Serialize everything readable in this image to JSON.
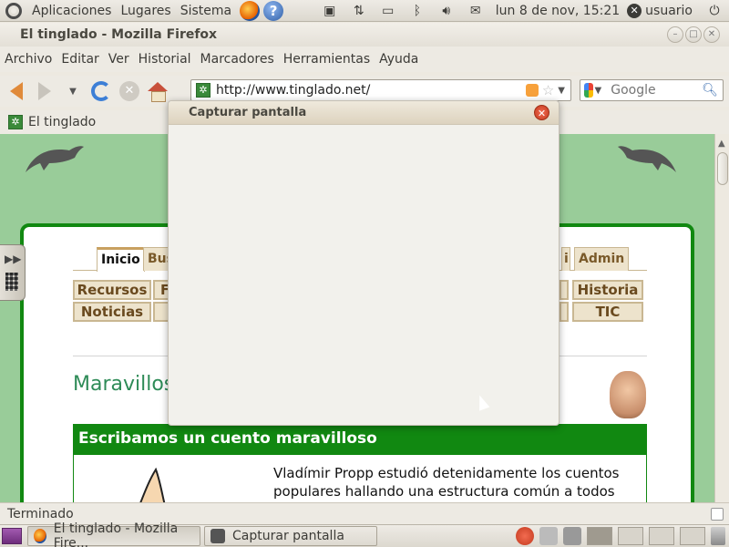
{
  "top_panel": {
    "menus": [
      "Aplicaciones",
      "Lugares",
      "Sistema"
    ],
    "clock": "lun  8 de nov, 15:21",
    "user": "usuario"
  },
  "firefox": {
    "window_title": "El tinglado - Mozilla Firefox",
    "menubar": [
      "Archivo",
      "Editar",
      "Ver",
      "Historial",
      "Marcadores",
      "Herramientas",
      "Ayuda"
    ],
    "url": "http://www.tinglado.net/",
    "search_placeholder": "Google",
    "tab_title": "El tinglado",
    "status": "Terminado"
  },
  "page": {
    "nav_tabs": [
      "Inicio",
      "Bus",
      "i",
      "Admin"
    ],
    "categories_left": [
      "Recursos",
      "Noticias"
    ],
    "categories_left_partial": [
      "F",
      ""
    ],
    "categories_right": [
      "Historia",
      "TIC"
    ],
    "section_heading": "Maravillos",
    "article_title": "Escribamos un cuento maravilloso",
    "article_text": "Vladímir Propp estudió detenidamente los cuentos populares hallando una estructura común a todos"
  },
  "dialog": {
    "title": "Capturar pantalla"
  },
  "bottom_panel": {
    "tasks": [
      {
        "label": "El tinglado - Mozilla Fire...",
        "icon": "firefox-icon"
      },
      {
        "label": "Capturar pantalla",
        "icon": "camera-icon"
      }
    ]
  },
  "colors": {
    "page_bg": "#99cc99",
    "site_green": "#118811",
    "heading_green": "#2e8b57"
  }
}
